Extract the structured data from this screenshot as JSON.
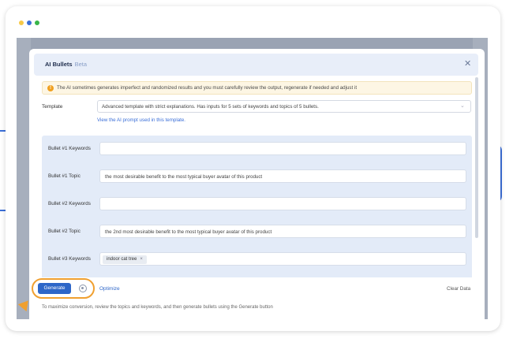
{
  "window": {
    "dot_colors": [
      "#f7c948",
      "#3b6fd8",
      "#39b54a"
    ]
  },
  "modal": {
    "title": "AI Bullets",
    "badge": "Beta",
    "close_icon": "close-icon"
  },
  "warning": {
    "icon": "alert-icon",
    "text": "The AI sometimes generates imperfect and randomized results and you must carefully review the output, regenerate if needed and adjust it"
  },
  "template": {
    "label": "Template",
    "value": "Advanced template with strict explanations. Has inputs for 5 sets of keywords and topics of 5 bullets.",
    "link_text": "View the AI prompt used in this template."
  },
  "bullets": [
    {
      "label": "Bullet #1 Keywords",
      "value": ""
    },
    {
      "label": "Bullet #1 Topic",
      "value": "the most desirable benefit to the most typical buyer avatar of this product"
    },
    {
      "label": "Bullet #2 Keywords",
      "value": ""
    },
    {
      "label": "Bullet #2 Topic",
      "value": "the 2nd most desirable benefit to the most typical buyer avatar of this product"
    },
    {
      "label": "Bullet #3 Keywords",
      "tag": "indoor cat tree",
      "tag_remove": "×"
    }
  ],
  "footer": {
    "generate_label": "Generate",
    "optimize_label": "Optimize",
    "clear_label": "Clear Data",
    "hint": "To maximize conversion, review the topics and keywords, and then generate bullets using the Generate button"
  },
  "colors": {
    "accent": "#2d66c8",
    "highlight": "#f0a030",
    "panel": "#e3ebf8",
    "warning_bg": "#fdf6e4"
  }
}
